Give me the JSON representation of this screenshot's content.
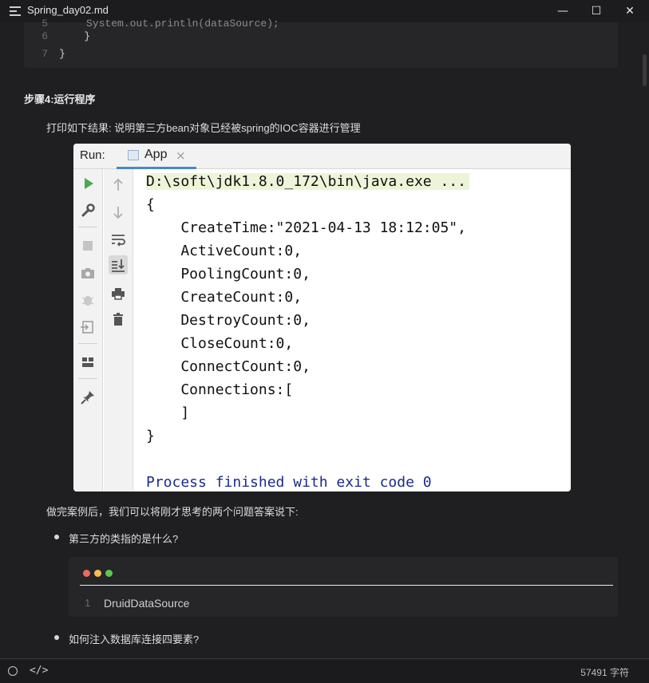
{
  "window": {
    "title": "Spring_day02.md",
    "minimize_glyph": "—",
    "maximize_glyph": "☐",
    "close_glyph": "✕"
  },
  "code_top": {
    "cut_text": "System.out.println(dataSource);",
    "lines": [
      {
        "num": "6",
        "text": "    }"
      },
      {
        "num": "7",
        "text": "}"
      }
    ]
  },
  "step_heading": "步骤4:运行程序",
  "intro_text": "打印如下结果: 说明第三方bean对象已经被spring的IOC容器进行管理",
  "run_panel": {
    "run_label": "Run:",
    "tab_label": "App",
    "tab_close": "×",
    "console_lines": [
      "D:\\soft\\jdk1.8.0_172\\bin\\java.exe ...",
      "{",
      "    CreateTime:\"2021-04-13 18:12:05\",",
      "    ActiveCount:0,",
      "    PoolingCount:0,",
      "    CreateCount:0,",
      "    DestroyCount:0,",
      "    CloseCount:0,",
      "    ConnectCount:0,",
      "    Connections:[",
      "    ]",
      "}",
      "",
      "Process finished with exit code 0"
    ]
  },
  "after_text": "做完案例后，我们可以将刚才思考的两个问题答案说下:",
  "list": [
    {
      "text": "第三方的类指的是什么?"
    },
    {
      "text": "如何注入数据库连接四要素?"
    }
  ],
  "code_block": {
    "line_number": "1",
    "code": "DruidDataSource",
    "dot_colors": [
      "#ec6a5e",
      "#f4bf4f",
      "#61c554"
    ]
  },
  "status": {
    "code_toggle": "</>",
    "char_count": "57491 字符"
  }
}
